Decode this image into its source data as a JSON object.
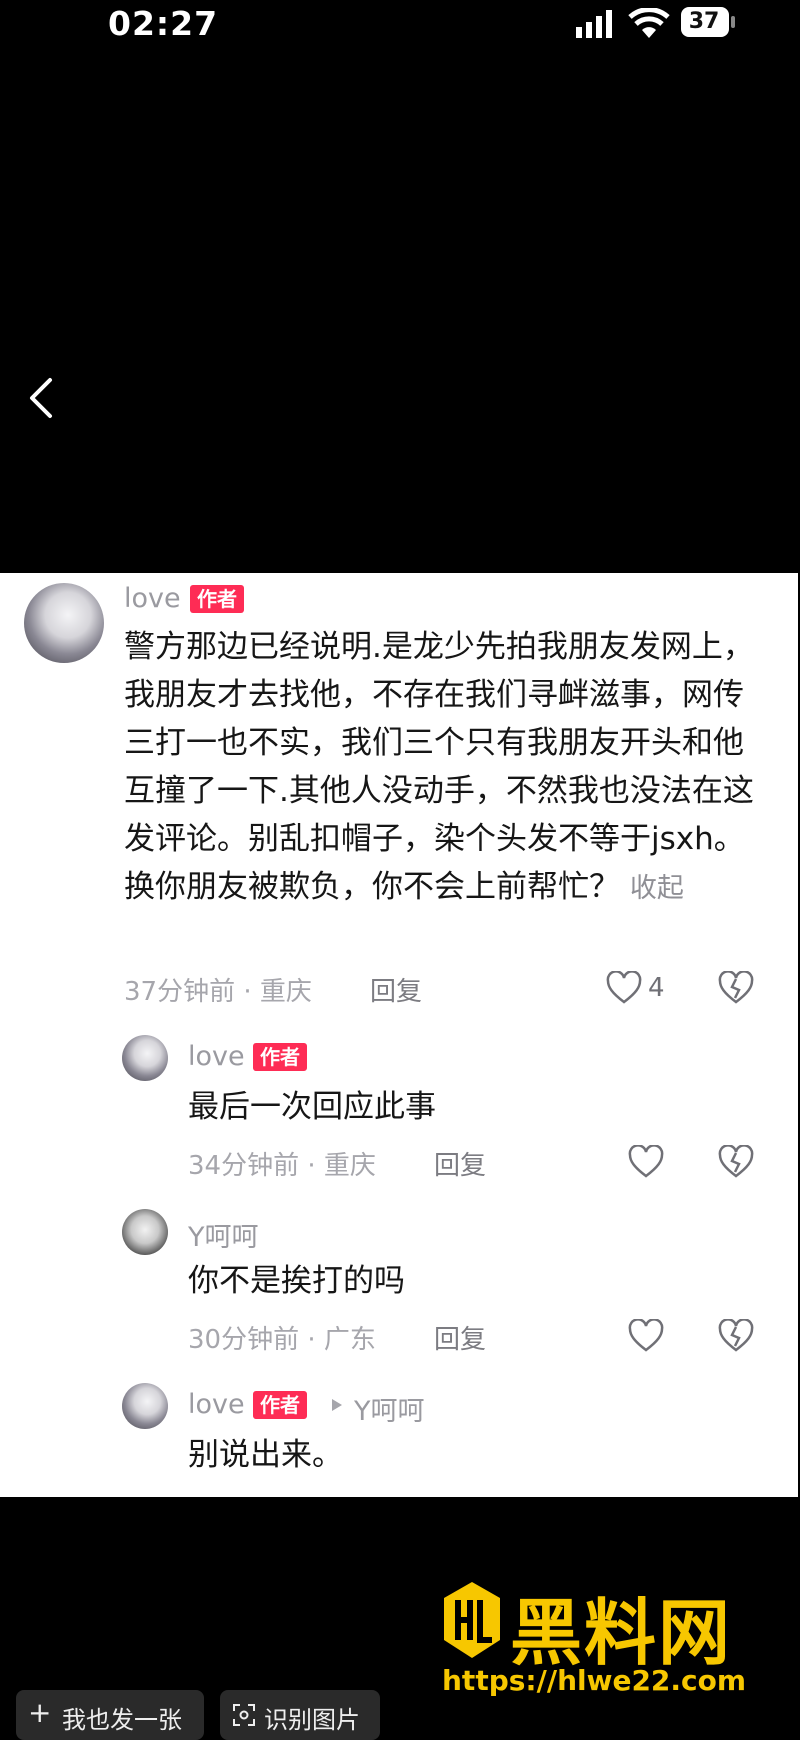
{
  "status_bar": {
    "time": "02:27",
    "battery": "37"
  },
  "comments": [
    {
      "username": "love",
      "badge": "作者",
      "text": "警方那边已经说明.是龙少先拍我朋友发网上，我朋友才去找他，不存在我们寻衅滋事，网传三打一也不实，我们三个只有我朋友开头和他互撞了一下.其他人没动手，不然我也没法在这发评论。别乱扣帽子，染个头发不等于jsxh。换你朋友被欺负，你不会上前帮忙？",
      "collapse_label": "收起",
      "time": "37分钟前",
      "location": "重庆",
      "reply_label": "回复",
      "likes": "4"
    },
    {
      "username": "love",
      "badge": "作者",
      "text": "最后一次回应此事",
      "time": "34分钟前",
      "location": "重庆",
      "reply_label": "回复"
    },
    {
      "username": "Y呵呵",
      "text": "你不是挨打的吗",
      "time": "30分钟前",
      "location": "广东",
      "reply_label": "回复"
    },
    {
      "username": "love",
      "badge": "作者",
      "reply_to": "Y呵呵",
      "text": "别说出来。"
    }
  ],
  "footer": {
    "post_label": "我也发一张",
    "recognize_label": "识别图片"
  },
  "watermark": {
    "brand": "黑料网",
    "url": "https://hlwe22.com"
  },
  "colors": {
    "badge": "#fe2c55",
    "watermark": "#f7c700"
  }
}
